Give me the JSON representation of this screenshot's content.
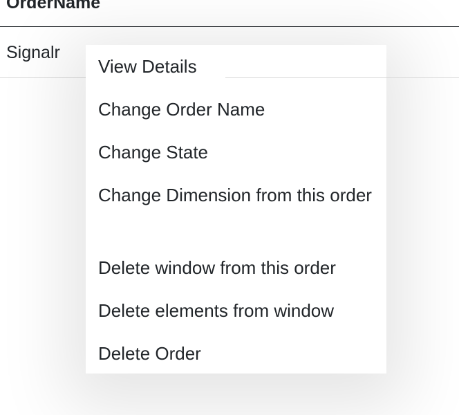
{
  "table": {
    "header": "OrderName",
    "rows": [
      {
        "order_name": "Signalr"
      }
    ]
  },
  "context_menu": {
    "items": [
      {
        "label": "View Details"
      },
      {
        "label": "Change Order Name"
      },
      {
        "label": "Change State"
      },
      {
        "label": "Change Dimension from this order"
      },
      {
        "label": "Delete window from this order"
      },
      {
        "label": "Delete elements from window"
      },
      {
        "label": "Delete Order"
      }
    ]
  }
}
